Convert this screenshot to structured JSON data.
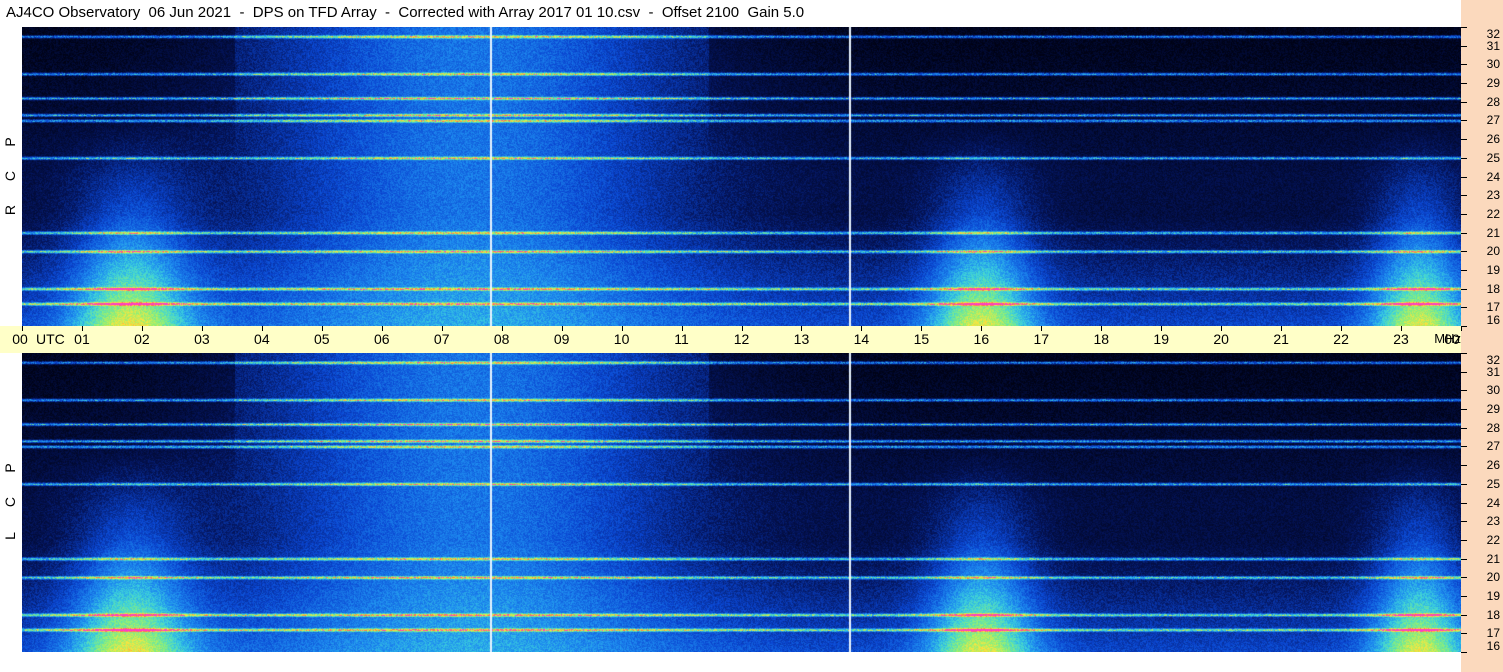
{
  "title": "AJ4CO Observatory  06 Jun 2021  -  DPS on TFD Array  -  Corrected with Array 2017 01 10.csv  -  Offset 2100  Gain 5.0",
  "chart_data": {
    "type": "heatmap",
    "title": "AJ4CO Observatory  06 Jun 2021  -  DPS on TFD Array  -  Corrected with Array 2017 01 10.csv  -  Offset 2100  Gain 5.0",
    "x_axis": {
      "ticks": [
        "00",
        "01",
        "02",
        "03",
        "04",
        "05",
        "06",
        "07",
        "08",
        "09",
        "10",
        "11",
        "12",
        "13",
        "14",
        "15",
        "16",
        "17",
        "18",
        "19",
        "20",
        "21",
        "22",
        "23",
        "00"
      ],
      "unit": "UTC",
      "range": [
        0,
        24
      ]
    },
    "y_axis": {
      "unit": "MHz",
      "ticks": [
        "16",
        "17",
        "18",
        "19",
        "20",
        "21",
        "22",
        "23",
        "24",
        "25",
        "26",
        "27",
        "28",
        "29",
        "30",
        "31",
        "32"
      ],
      "range": [
        16,
        32
      ]
    },
    "panels": [
      {
        "label": [
          "R",
          "C",
          "P"
        ],
        "name": "RCP"
      },
      {
        "label": [
          "L",
          "C",
          "P"
        ],
        "name": "LCP"
      }
    ],
    "markers_utc": [
      7.8,
      13.8
    ],
    "interference_bands_mhz": [
      27.3,
      27.0,
      17.2,
      18.0,
      20.0,
      21.0,
      25.0,
      28.2,
      29.5,
      31.5
    ],
    "colors": {
      "background_dark": "#000418",
      "background_blue": "#0a4fd6",
      "noise_high": "#ffe040",
      "rfi": "#ff40c0"
    }
  },
  "axis": {
    "utc_label": "UTC",
    "mhz_label": "MHz"
  }
}
